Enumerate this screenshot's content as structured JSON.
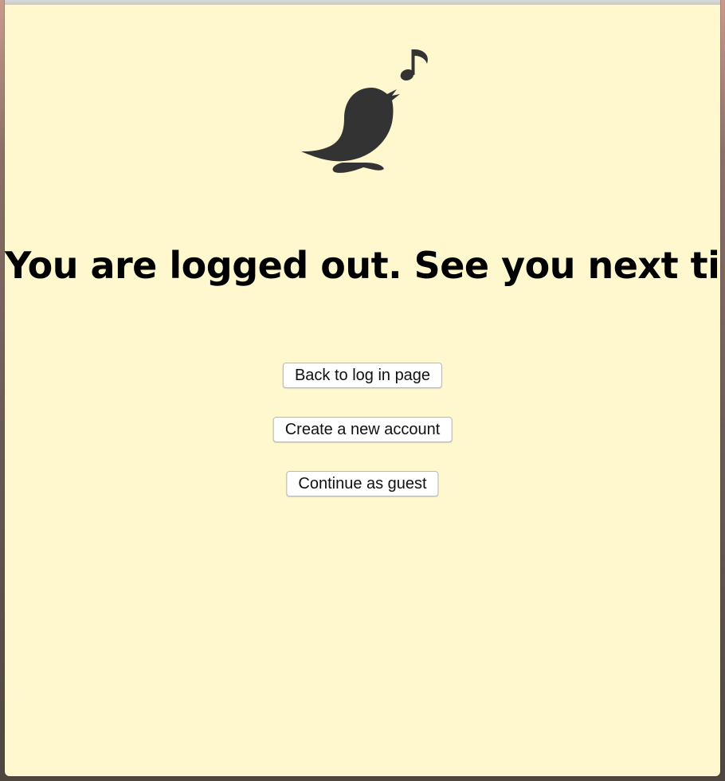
{
  "page": {
    "message": "You are logged out. See you next time!"
  },
  "actions": {
    "back_to_login": "Back to log in page",
    "create_account": "Create a new account",
    "continue_guest": "Continue as guest"
  },
  "colors": {
    "background": "#fff8cf",
    "logo": "#333333"
  },
  "icons": {
    "logo": "singing-bird-icon"
  }
}
